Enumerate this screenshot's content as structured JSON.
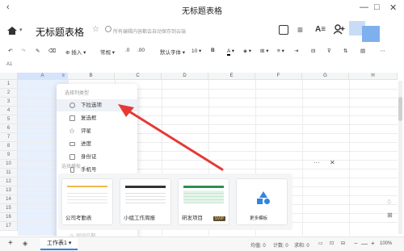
{
  "window": {
    "title": "无标题表格",
    "back_icon": "chevron-left-icon",
    "minimize": "—",
    "maximize": "□",
    "close": "✕"
  },
  "header": {
    "doc_title": "无标题表格",
    "save_hint": "所有编辑内容都会自动保存到云端",
    "aa_label": "A≡"
  },
  "toolbar": {
    "insert": "插入",
    "format": "常规",
    "font": "默认字体",
    "size": "10",
    "bold": "B",
    "font_color": "A"
  },
  "formula": {
    "cell_ref": "A1"
  },
  "sheet": {
    "columns": [
      "A",
      "B",
      "C",
      "D",
      "E",
      "F",
      "G",
      "H"
    ],
    "rows": [
      "1",
      "2",
      "3",
      "4",
      "5",
      "6",
      "7",
      "8",
      "9",
      "10",
      "11",
      "12",
      "13",
      "14",
      "15",
      "16",
      "17"
    ],
    "ellipsis": "···",
    "close": "✕"
  },
  "menu": {
    "header": "选择列类型",
    "items": [
      {
        "label": "下拉选项",
        "icon": "dropdown-icon",
        "highlighted": true
      },
      {
        "label": "复选框",
        "icon": "checkbox-icon",
        "highlighted": false
      },
      {
        "label": "评星",
        "icon": "star-icon",
        "highlighted": false
      },
      {
        "label": "进度",
        "icon": "progress-icon",
        "highlighted": false
      },
      {
        "label": "身份证",
        "icon": "id-card-icon",
        "highlighted": false
      },
      {
        "label": "手机号",
        "icon": "phone-icon",
        "highlighted": false
      }
    ],
    "template_header": "选择模板",
    "footer_item": "时间日期"
  },
  "templates": [
    {
      "label": "公司考勤表"
    },
    {
      "label": "小组工作周报"
    },
    {
      "label": "研发项目",
      "badge": "SVIP"
    },
    {
      "label": "更多模板"
    }
  ],
  "bottom": {
    "add": "+",
    "sheet_tab": "工作表1",
    "stats": [
      "均值: 0",
      "计数: 0",
      "求和: 0"
    ],
    "zoom": "100%"
  },
  "colors": {
    "accent": "#3b82f6",
    "arrow": "#e53935",
    "selected_col": "#e8f0fd",
    "header_bg": "#f4f5f7"
  }
}
